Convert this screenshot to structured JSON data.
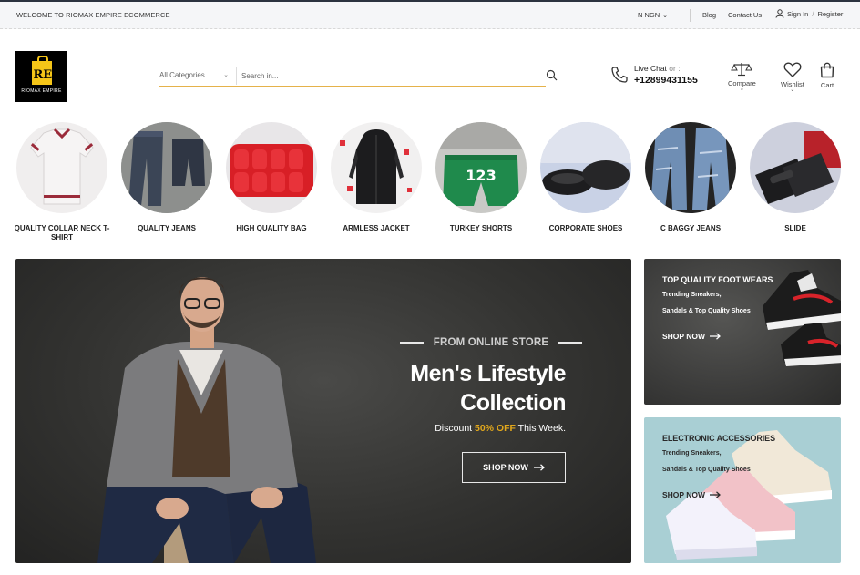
{
  "topbar": {
    "welcome": "WELCOME TO RIOMAX EMPIRE ECOMMERCE",
    "currency": "N NGN",
    "blog": "Blog",
    "contact": "Contact Us",
    "signin": "Sign In",
    "separator": "/",
    "register": "Register"
  },
  "logo": {
    "mark": "RE",
    "name": "RIOMAX EMPIRE"
  },
  "search": {
    "category": "All Categories",
    "placeholder": "Search in..."
  },
  "header": {
    "live_chat": "Live Chat",
    "or": "or :",
    "phone": "+12899431155",
    "compare": "Compare",
    "wishlist": "Wishlist",
    "cart": "Cart"
  },
  "categories": [
    {
      "label": "QUALITY COLLAR NECK T-SHIRT"
    },
    {
      "label": "QUALITY JEANS"
    },
    {
      "label": "HIGH QUALITY BAG"
    },
    {
      "label": "ARMLESS JACKET"
    },
    {
      "label": "TURKEY SHORTS"
    },
    {
      "label": "CORPORATE SHOES"
    },
    {
      "label": "C BAGGY JEANS"
    },
    {
      "label": "SLIDE"
    }
  ],
  "hero": {
    "kicker": "FROM ONLINE STORE",
    "title_line1": "Men's Lifestyle",
    "title_line2": "Collection",
    "discount_pre": "Discount",
    "discount_value": "50% OFF",
    "discount_post": "This Week.",
    "cta": "SHOP NOW"
  },
  "side_banner_1": {
    "title": "TOP QUALITY FOOT WEARS",
    "line1": "Trending Sneakers,",
    "line2": "Sandals & Top Quality Shoes",
    "cta": "SHOP NOW"
  },
  "side_banner_2": {
    "title": "ELECTRONIC ACCESSORIES",
    "line1": "Trending Sneakers,",
    "line2": "Sandals & Top Quality Shoes",
    "cta": "SHOP NOW"
  },
  "colors": {
    "accent": "#e2a81c",
    "dark": "#2c3340"
  }
}
